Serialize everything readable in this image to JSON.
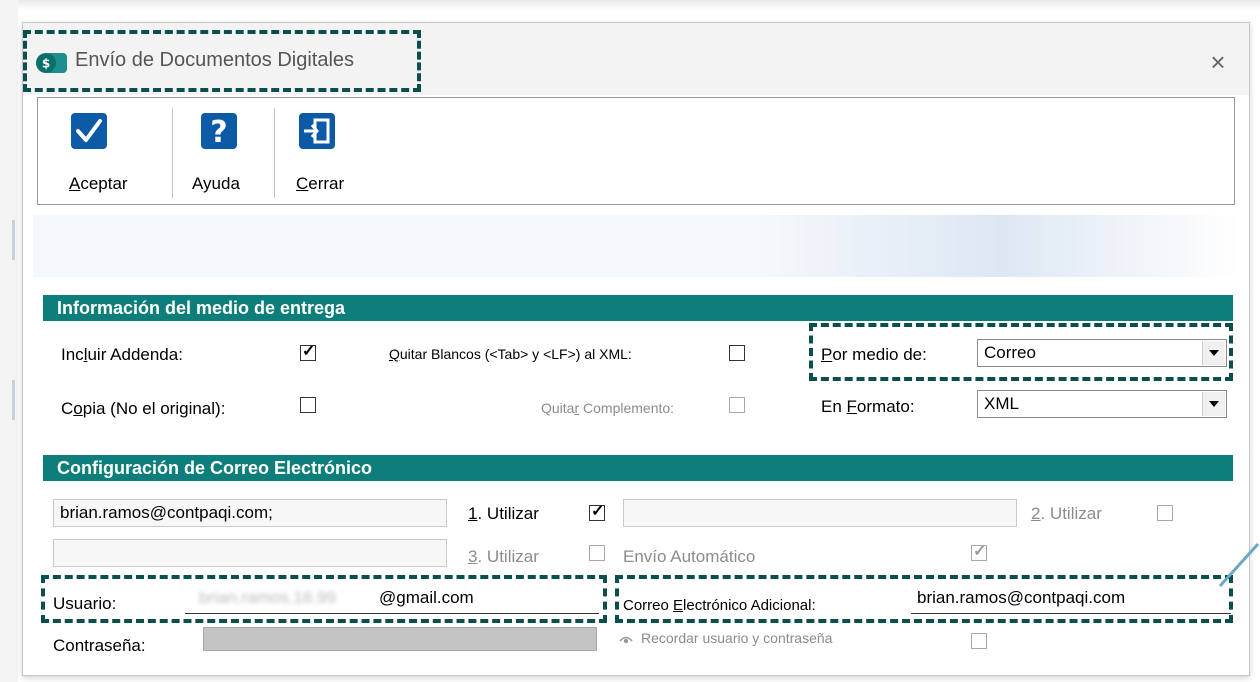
{
  "window": {
    "title": "Envío de Documentos Digitales",
    "close_symbol": "×"
  },
  "toolbar": {
    "aceptar": {
      "label_u": "A",
      "label_rest": "ceptar"
    },
    "ayuda": {
      "label": "Ayuda"
    },
    "cerrar": {
      "label_u": "C",
      "label_rest": "errar"
    }
  },
  "delivery": {
    "header": "Información del medio de entrega",
    "incluir_addenda": {
      "label_pre": "Inc",
      "label_u": "l",
      "label_post": "uir Addenda:",
      "checked": true
    },
    "copia": {
      "label_pre": "C",
      "label_u": "o",
      "label_post": "pia (No el original):",
      "checked": false
    },
    "quitar_blancos": {
      "label_u": "Q",
      "label_rest": "uitar Blancos (<Tab> y <LF>) al XML:",
      "checked": false
    },
    "quitar_complemento": {
      "label_pre": "Quita",
      "label_u": "r",
      "label_post": " Complemento:",
      "checked": false
    },
    "por_medio": {
      "label_u": "P",
      "label_rest": "or medio de:",
      "value": "Correo"
    },
    "en_formato": {
      "label_pre": "En ",
      "label_u": "F",
      "label_post": "ormato:",
      "value": "XML"
    }
  },
  "email": {
    "header": "Configuración de Correo Electrónico",
    "address1": "brian.ramos@contpaqi.com;",
    "utilizar1": {
      "label_u": "1",
      "label_rest": ". Utilizar",
      "checked": true
    },
    "address2": "",
    "utilizar2": {
      "label_u": "2",
      "label_rest": ". Utilizar",
      "checked": false
    },
    "address3": "",
    "utilizar3": {
      "label_u": "3",
      "label_rest": ". Utilizar",
      "checked": false
    },
    "envio_automatico": {
      "label": "Envío Automático",
      "checked": true
    },
    "usuario": {
      "label": "Usuario:",
      "value_blurred": "brian.ramos.18.99",
      "value_visible": "@gmail.com"
    },
    "correo_adicional": {
      "label_pre": "Correo ",
      "label_u": "E",
      "label_post": "lectrónico Adicional:",
      "value": "brian.ramos@contpaqi.com"
    },
    "contrasena": {
      "label": "Contraseña:"
    },
    "recordar": {
      "label": "Recordar usuario y contraseña",
      "checked": false
    }
  },
  "colors": {
    "section_header": "#0e7e7a",
    "dashed_highlight": "#0a4f4d",
    "icon_blue": "#0d5aa7"
  }
}
